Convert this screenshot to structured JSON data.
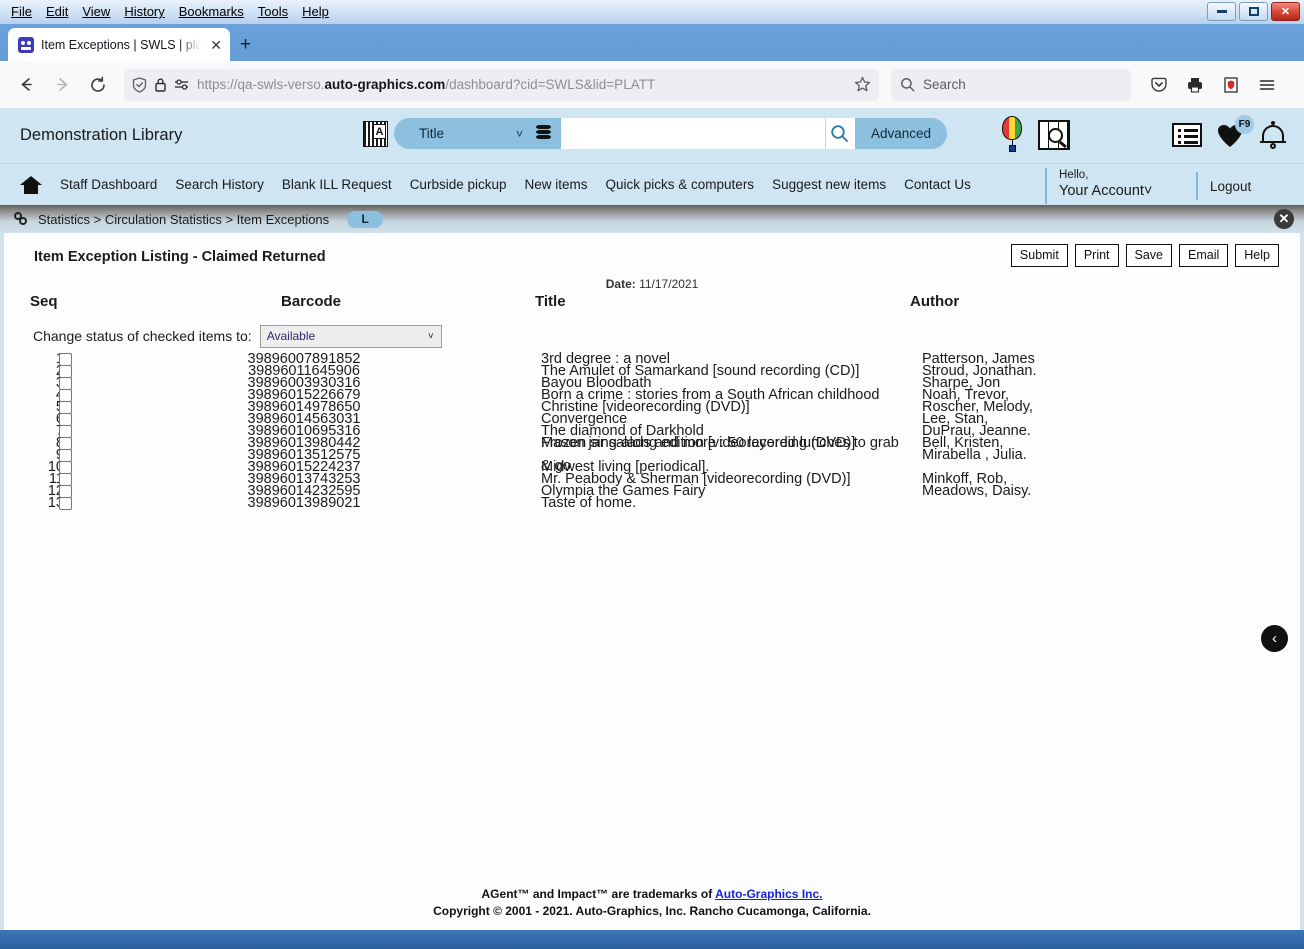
{
  "window": {
    "menus": [
      "File",
      "Edit",
      "View",
      "History",
      "Bookmarks",
      "Tools",
      "Help"
    ],
    "minimize_label": "–",
    "maximize_label": "□",
    "close_label": "✕"
  },
  "browser": {
    "tab_title": "Item Exceptions | SWLS | platt | A",
    "tab_close_label": "✕",
    "new_tab_label": "+",
    "back_label": "←",
    "forward_label": "→",
    "reload_label": "⟳",
    "url_prefix": "https://qa-swls-verso.",
    "url_domain": "auto-graphics.com",
    "url_suffix": "/dashboard?cid=SWLS&lid=PLATT",
    "bookmark_label": "☆",
    "search_placeholder": "Search",
    "search_value": "",
    "shield_label": "⛉",
    "lock_label": "ὑ2",
    "pocket_label": "⬇",
    "print_label": "⎙",
    "extension_label": "U",
    "menu_label": "☰"
  },
  "app": {
    "library_name": "Demonstration Library",
    "search": {
      "scope_value": "Title",
      "scope_chevron": "˅",
      "query_value": "",
      "go_label": "⌕",
      "advanced_label": "Advanced"
    },
    "header_icons": [
      {
        "name": "balloon-icon"
      },
      {
        "name": "book-search-icon"
      },
      {
        "name": "list-icon"
      },
      {
        "name": "favorites-heart-icon",
        "badge": "F9"
      },
      {
        "name": "notifications-bell-icon"
      }
    ],
    "nav_links": [
      "Staff Dashboard",
      "Search History",
      "Blank ILL Request",
      "Curbside pickup",
      "New items",
      "Quick picks & computers",
      "Suggest new items",
      "Contact Us"
    ],
    "account": {
      "hello": "Hello,",
      "name": "Your Account",
      "chevron": "˅",
      "logout": "Logout"
    },
    "breadcrumb": {
      "text": "Statistics > Circulation Statistics > Item Exceptions",
      "badge": "L",
      "close_label": "✕"
    }
  },
  "page": {
    "title": "Item Exception Listing - Claimed Returned",
    "date_label": "Date:",
    "date_value": "11/17/2021",
    "buttons": [
      "Submit",
      "Print",
      "Save",
      "Email",
      "Help"
    ],
    "columns": {
      "seq": "Seq",
      "barcode": "Barcode",
      "title": "Title",
      "author": "Author"
    },
    "status_change": {
      "label": "Change status of checked items to:",
      "selected": "Available",
      "chevron": "˅"
    },
    "collapse_arrow": "‹",
    "rows": [
      {
        "seq": "1.",
        "barcode": "39896007891852",
        "title": "3rd degree : a novel",
        "author": "Patterson, James"
      },
      {
        "seq": "2.",
        "barcode": "39896011645906",
        "title": "The Amulet of Samarkand [sound recording (CD)]",
        "author": "Stroud, Jonathan."
      },
      {
        "seq": "3.",
        "barcode": "39896003930316",
        "title": "Bayou Bloodbath",
        "author": "Sharpe, Jon"
      },
      {
        "seq": "4.",
        "barcode": "39896015226679",
        "title": "Born a crime : stories from a South African childhood",
        "author": "Noah, Trevor,"
      },
      {
        "seq": "5.",
        "barcode": "39896014978650",
        "title": "Christine [videorecording (DVD)]",
        "author": "Roscher, Melody,"
      },
      {
        "seq": "6.",
        "barcode": "39896014563031",
        "title": "Convergence",
        "author": "Lee, Stan,"
      },
      {
        "seq": "7.",
        "barcode": "39896010695316",
        "title": "The diamond of Darkhold",
        "author": "DuPrau, Jeanne."
      },
      {
        "seq": "8.",
        "barcode": "39896013980442",
        "title": "Frozen sing-along edition [videorecording (DVD)]",
        "author": "Bell, Kristen,"
      },
      {
        "seq": "9.",
        "barcode": "39896013512575",
        "title": "Mason jar salads and more : 50 layered lunches to grab & go",
        "author": "Mirabella , Julia."
      },
      {
        "seq": "10.",
        "barcode": "39896015224237",
        "title": "Midwest living [periodical].",
        "author": ""
      },
      {
        "seq": "11.",
        "barcode": "39896013743253",
        "title": "Mr. Peabody & Sherman [videorecording (DVD)]",
        "author": "Minkoff, Rob,"
      },
      {
        "seq": "12.",
        "barcode": "39896014232595",
        "title": "Olympia the Games Fairy",
        "author": "Meadows, Daisy."
      },
      {
        "seq": "13.",
        "barcode": "39896013989021",
        "title": "Taste of home.",
        "author": ""
      }
    ],
    "footer": {
      "line1_pre": "AGent™ and Impact™ are trademarks of ",
      "link": "Auto-Graphics Inc.",
      "line2": "Copyright © 2001 - 2021. Auto-Graphics, Inc. Rancho Cucamonga, California."
    }
  },
  "colors": {
    "header_blue": "#cfe5f2",
    "accent_blue": "#8cc0de",
    "link_blue": "#1a23d6",
    "desktop_blue": "#2b5f9e"
  }
}
